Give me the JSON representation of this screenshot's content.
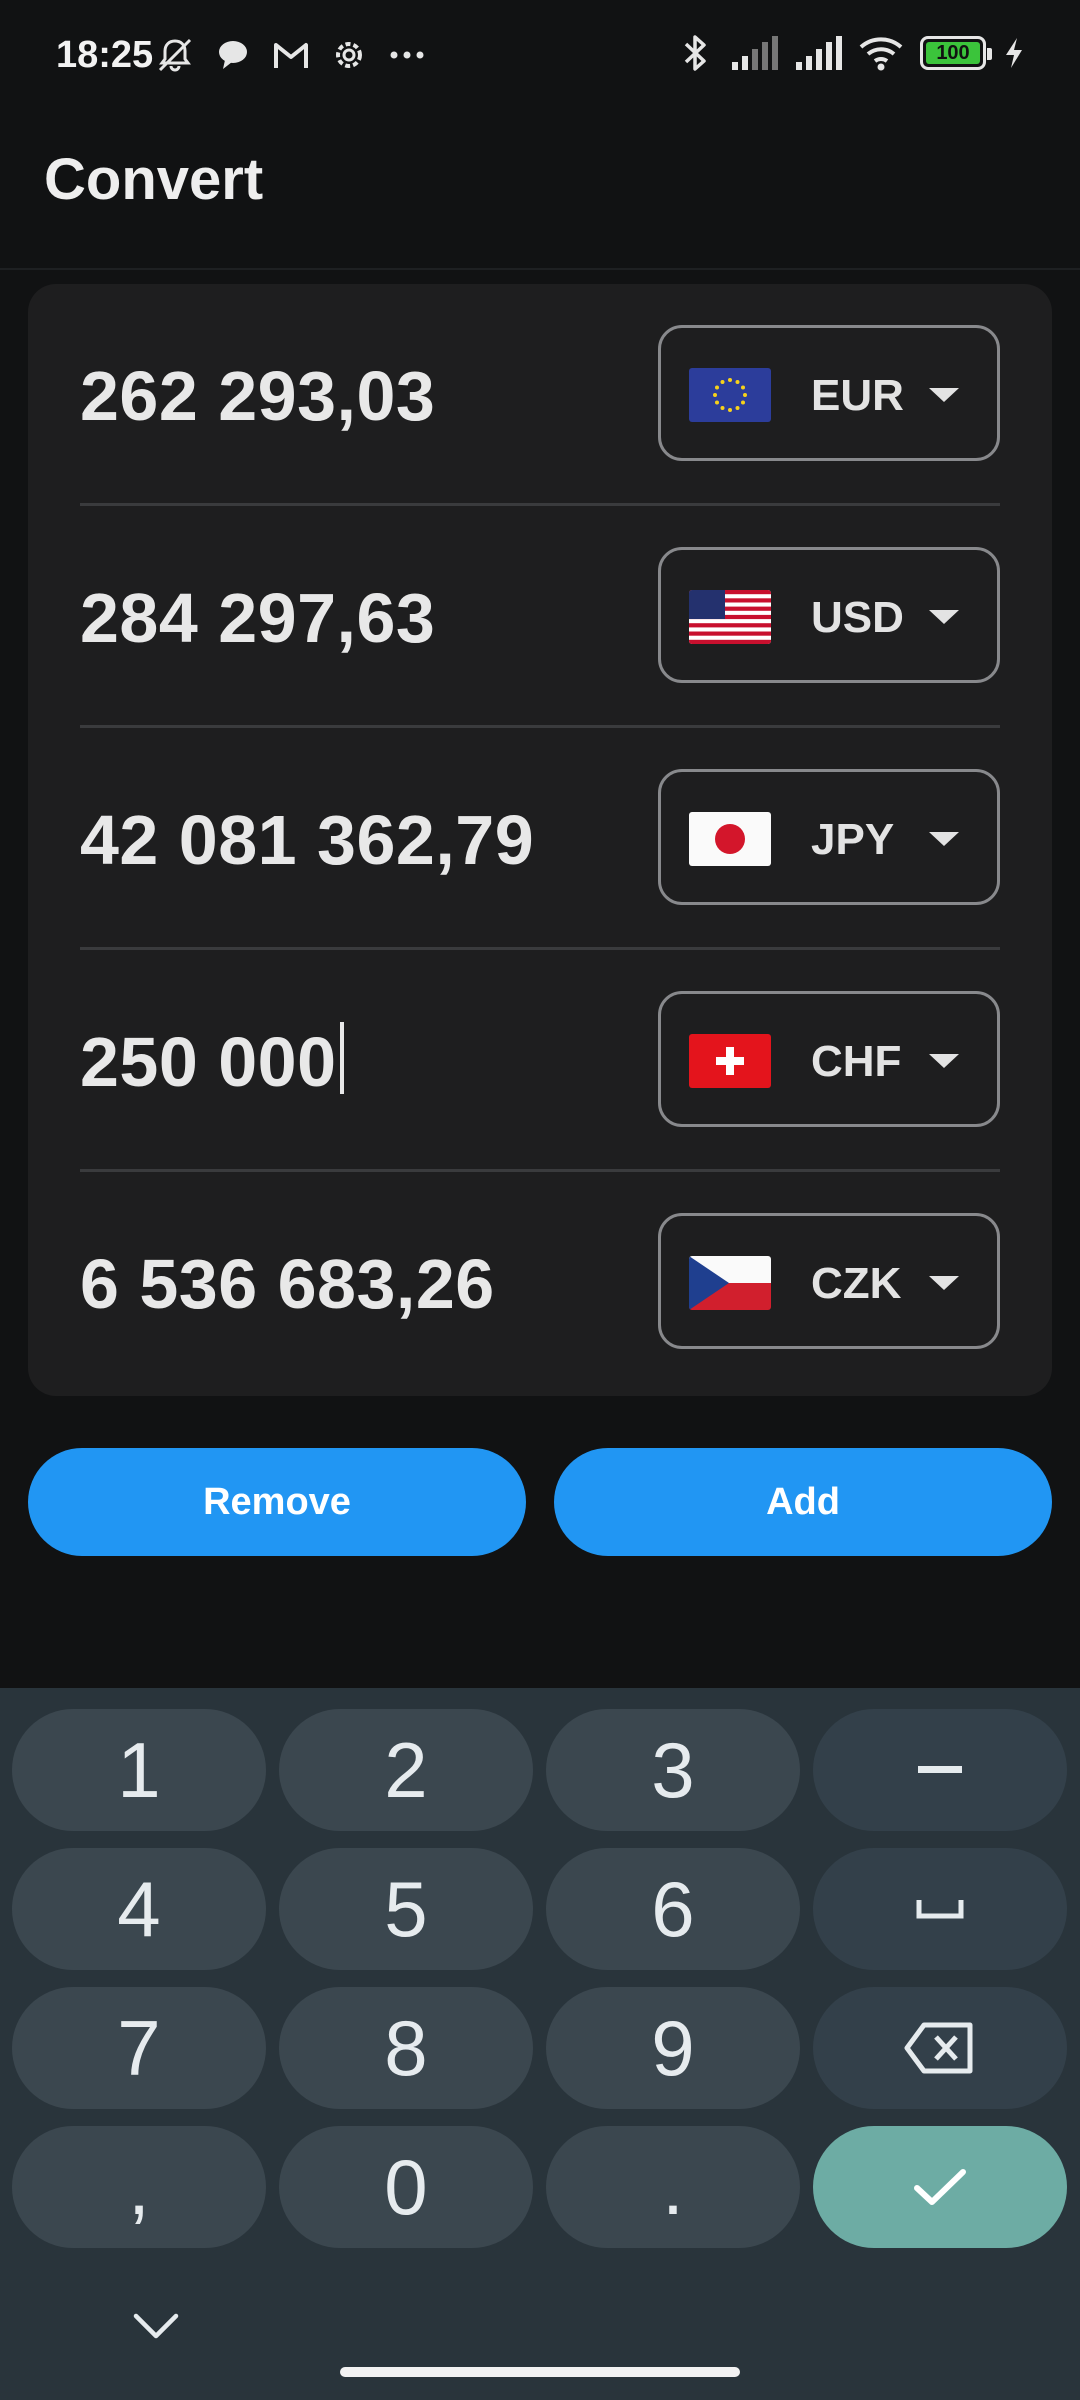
{
  "status_bar": {
    "time": "18:25",
    "battery_level": "100",
    "battery_color": "#3bc43b",
    "left_icons": [
      "bell-off-icon",
      "chat-icon",
      "gmail-icon",
      "settings-icon",
      "more-dots-icon"
    ],
    "right_icons": [
      "bluetooth-icon",
      "signal-icon",
      "signal-icon",
      "wifi-icon",
      "battery-icon",
      "charging-icon"
    ]
  },
  "app_bar": {
    "title": "Convert"
  },
  "rows": [
    {
      "amount": "262 293,03",
      "currency": "EUR",
      "flag": "eu-flag-icon"
    },
    {
      "amount": "284 297,63",
      "currency": "USD",
      "flag": "us-flag-icon"
    },
    {
      "amount": "42 081 362,79",
      "currency": "JPY",
      "flag": "jp-flag-icon"
    },
    {
      "amount": "250 000",
      "currency": "CHF",
      "flag": "ch-flag-icon",
      "focused": true
    },
    {
      "amount": "6 536 683,26",
      "currency": "CZK",
      "flag": "cz-flag-icon"
    }
  ],
  "actions": {
    "remove_label": "Remove",
    "add_label": "Add",
    "accent": "#2196f3"
  },
  "keyboard": {
    "keys": [
      "1",
      "2",
      "3",
      "–",
      "4",
      "5",
      "6",
      "␣",
      "7",
      "8",
      "9",
      "⌫",
      ",",
      "0",
      ".",
      "✓"
    ],
    "done_color": "#6daca4"
  }
}
